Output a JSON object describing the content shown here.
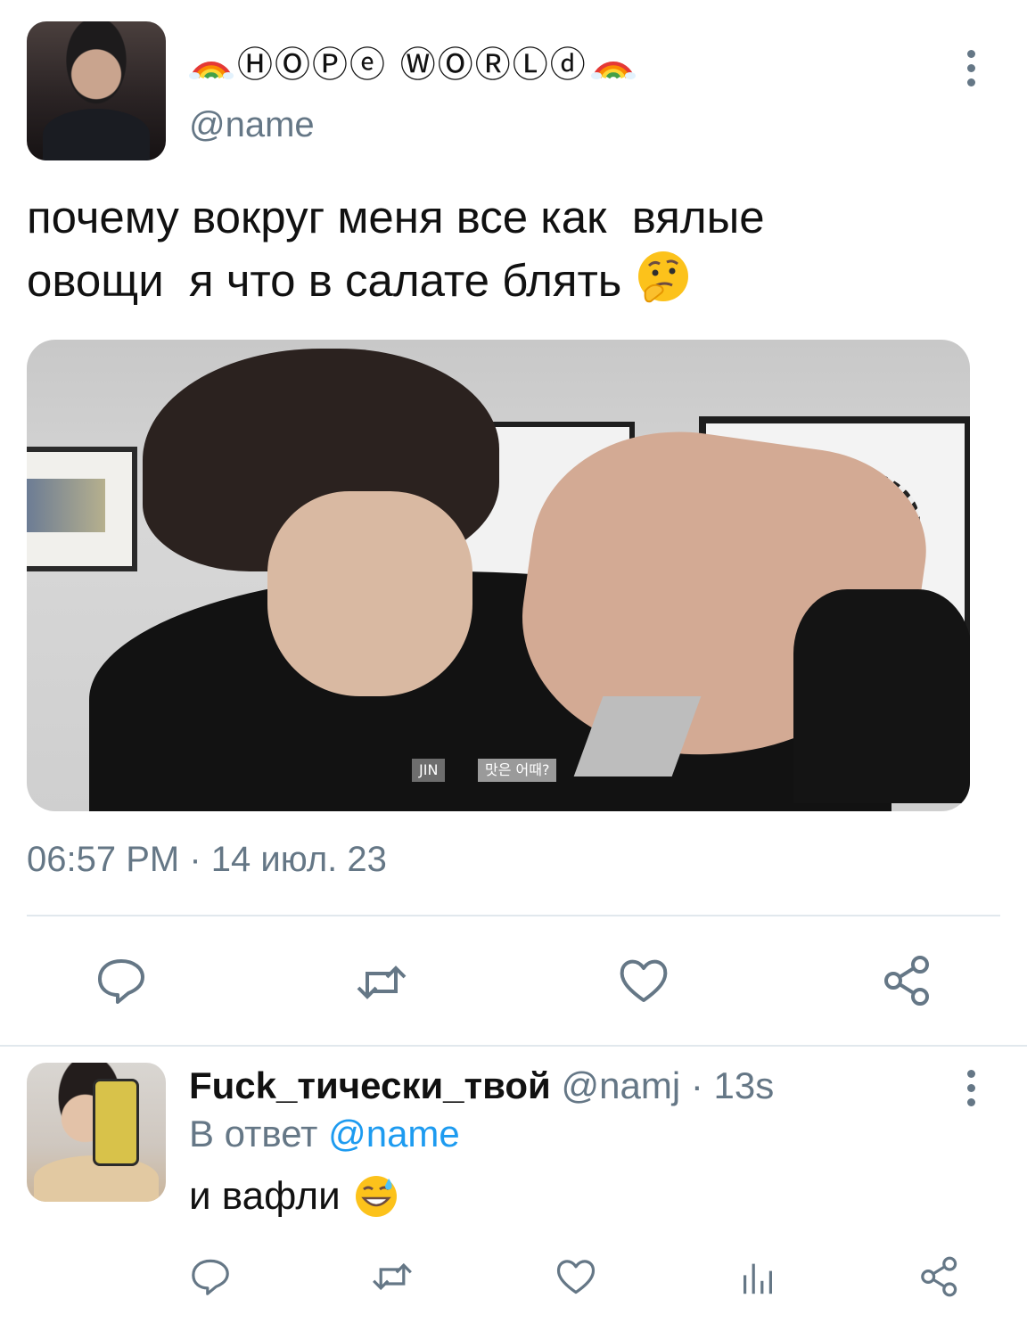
{
  "tweet": {
    "display_name": "ⒽⓄⓅⓔ ⓌⓄⓇⓁⓓ",
    "handle": "@name",
    "text": "почему вокруг меня все как  вялые\nовощи  я что в салате блять",
    "emoji": "thinking-face",
    "timestamp": "06:57 PM · 14 июл. 23",
    "media_tags": [
      "JIN",
      "맛은 어때?"
    ],
    "actions": [
      "reply",
      "retweet",
      "like",
      "share"
    ]
  },
  "reply": {
    "display_name": "Fuck_тически_твой",
    "meta": "@namj · 13s",
    "reply_prefix": "В ответ",
    "reply_mention": "@name",
    "text": "и вафли",
    "emoji": "grinning-sweat-face",
    "actions": [
      "reply",
      "retweet",
      "like",
      "views",
      "share"
    ]
  },
  "colors": {
    "secondary_text": "#657786",
    "mention": "#1d9bf0",
    "divider": "#e1e8ed"
  }
}
